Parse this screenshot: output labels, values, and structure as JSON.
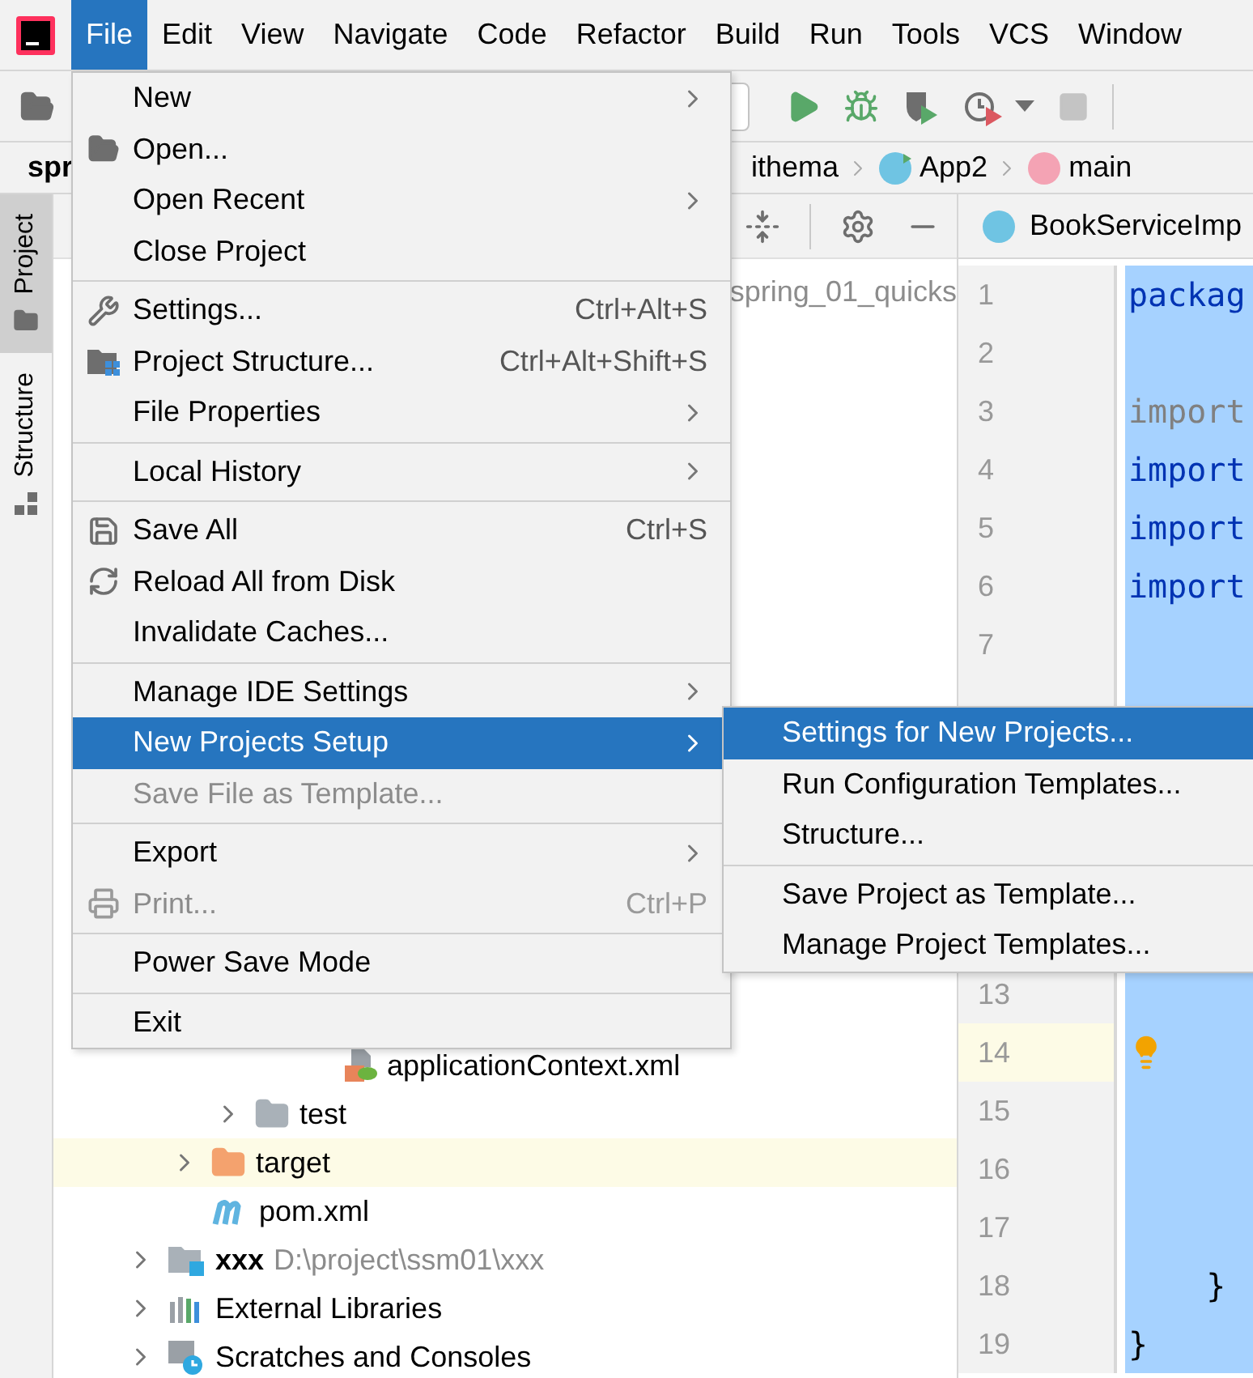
{
  "menu_bar": [
    {
      "label": "File",
      "selected": true
    },
    {
      "label": "Edit",
      "selected": false
    },
    {
      "label": "View",
      "selected": false
    },
    {
      "label": "Navigate",
      "selected": false
    },
    {
      "label": "Code",
      "selected": false
    },
    {
      "label": "Refactor",
      "selected": false
    },
    {
      "label": "Build",
      "selected": false
    },
    {
      "label": "Run",
      "selected": false
    },
    {
      "label": "Tools",
      "selected": false
    },
    {
      "label": "VCS",
      "selected": false
    },
    {
      "label": "Window",
      "selected": false
    }
  ],
  "breadcrumb": {
    "project": "spr",
    "items": [
      {
        "label": "ithema",
        "kind": "package"
      },
      {
        "label": "App2",
        "kind": "class"
      },
      {
        "label": "main",
        "kind": "method"
      }
    ]
  },
  "side_tabs": [
    {
      "label": "Project",
      "kind": "project",
      "selected": true
    },
    {
      "label": "Structure",
      "kind": "structure",
      "selected": false
    }
  ],
  "project_tree": {
    "top_row": "spring_01_quicks",
    "nodes": [
      {
        "children": [
          {
            "children": [
              {
                "children": [
                  {
                    "children": [
                      {
                        "name": "applicationContext.xml",
                        "kind": "xml",
                        "highlighted": false
                      }
                    ]
                  }
                ]
              },
              {
                "name": "test",
                "kind": "folder",
                "expanded": false,
                "highlighted": false
              }
            ]
          },
          {
            "name": "target",
            "kind": "excluded",
            "expanded": false,
            "highlighted": true
          },
          {
            "name": "pom.xml",
            "kind": "maven",
            "highlighted": false
          }
        ]
      },
      {
        "name": "xxx",
        "path": "D:\\project\\ssm01\\xxx",
        "kind": "module",
        "expanded": false,
        "highlighted": false
      },
      {
        "name": "External Libraries",
        "kind": "libraries",
        "expanded": false,
        "highlighted": false
      },
      {
        "name": "Scratches and Consoles",
        "kind": "scratches",
        "expanded": false,
        "highlighted": false
      }
    ]
  },
  "editor": {
    "tab": "BookServiceImp",
    "lines": [
      {
        "number": "1",
        "code": "packag",
        "kind": "keyword",
        "current": false
      },
      {
        "number": "2",
        "current": false
      },
      {
        "number": "3",
        "code": "import",
        "kind": "unused",
        "current": false
      },
      {
        "number": "4",
        "code": "import",
        "kind": "keyword",
        "current": false
      },
      {
        "number": "5",
        "code": "import",
        "kind": "keyword",
        "current": false
      },
      {
        "number": "6",
        "code": "import",
        "kind": "keyword",
        "current": false
      },
      {
        "number": "7",
        "current": false
      },
      {
        "number": "13",
        "current": false
      },
      {
        "number": "14",
        "current": true
      },
      {
        "number": "15",
        "current": false
      },
      {
        "number": "16",
        "current": false
      },
      {
        "number": "17",
        "current": false
      },
      {
        "number": "18",
        "code": "    }",
        "kind": "plain",
        "current": false
      },
      {
        "number": "19",
        "code": "}",
        "kind": "plain",
        "current": false
      }
    ]
  },
  "file_menu": [
    {
      "kind": "plain",
      "label": "New",
      "submenu": true,
      "selected": false,
      "disabled": false
    },
    {
      "kind": "folder",
      "label": "Open...",
      "selected": false,
      "disabled": false
    },
    {
      "kind": "plain",
      "label": "Open Recent",
      "submenu": true,
      "selected": false,
      "disabled": false
    },
    {
      "kind": "plain",
      "label": "Close Project",
      "selected": false,
      "disabled": false
    },
    {
      "kind": "separator"
    },
    {
      "kind": "wrench",
      "label": "Settings...",
      "shortcut": "Ctrl+Alt+S",
      "selected": false,
      "disabled": false
    },
    {
      "kind": "structure",
      "label": "Project Structure...",
      "shortcut": "Ctrl+Alt+Shift+S",
      "selected": false,
      "disabled": false
    },
    {
      "kind": "plain",
      "label": "File Properties",
      "submenu": true,
      "selected": false,
      "disabled": false
    },
    {
      "kind": "separator"
    },
    {
      "kind": "plain",
      "label": "Local History",
      "submenu": true,
      "selected": false,
      "disabled": false
    },
    {
      "kind": "separator"
    },
    {
      "kind": "save",
      "label": "Save All",
      "shortcut": "Ctrl+S",
      "selected": false,
      "disabled": false
    },
    {
      "kind": "reload",
      "label": "Reload All from Disk",
      "selected": false,
      "disabled": false
    },
    {
      "kind": "plain",
      "label": "Invalidate Caches...",
      "selected": false,
      "disabled": false
    },
    {
      "kind": "separator"
    },
    {
      "kind": "plain",
      "label": "Manage IDE Settings",
      "submenu": true,
      "selected": false,
      "disabled": false
    },
    {
      "kind": "plain",
      "label": "New Projects Setup",
      "submenu": true,
      "selected": true,
      "disabled": false
    },
    {
      "kind": "plain",
      "label": "Save File as Template...",
      "selected": false,
      "disabled": true
    },
    {
      "kind": "separator"
    },
    {
      "kind": "plain",
      "label": "Export",
      "submenu": true,
      "selected": false,
      "disabled": false
    },
    {
      "kind": "print",
      "label": "Print...",
      "shortcut": "Ctrl+P",
      "selected": false,
      "disabled": true
    },
    {
      "kind": "separator"
    },
    {
      "kind": "plain",
      "label": "Power Save Mode",
      "selected": false,
      "disabled": false
    },
    {
      "kind": "separator"
    },
    {
      "kind": "plain",
      "label": "Exit",
      "selected": false,
      "disabled": false
    }
  ],
  "submenu": [
    {
      "kind": "plain",
      "label": "Settings for New Projects...",
      "selected": true
    },
    {
      "kind": "plain",
      "label": "Run Configuration Templates...",
      "selected": false
    },
    {
      "kind": "plain",
      "label": "Structure...",
      "selected": false
    },
    {
      "kind": "separator"
    },
    {
      "kind": "plain",
      "label": "Save Project as Template...",
      "selected": false
    },
    {
      "kind": "plain",
      "label": "Manage Project Templates...",
      "selected": false
    }
  ]
}
